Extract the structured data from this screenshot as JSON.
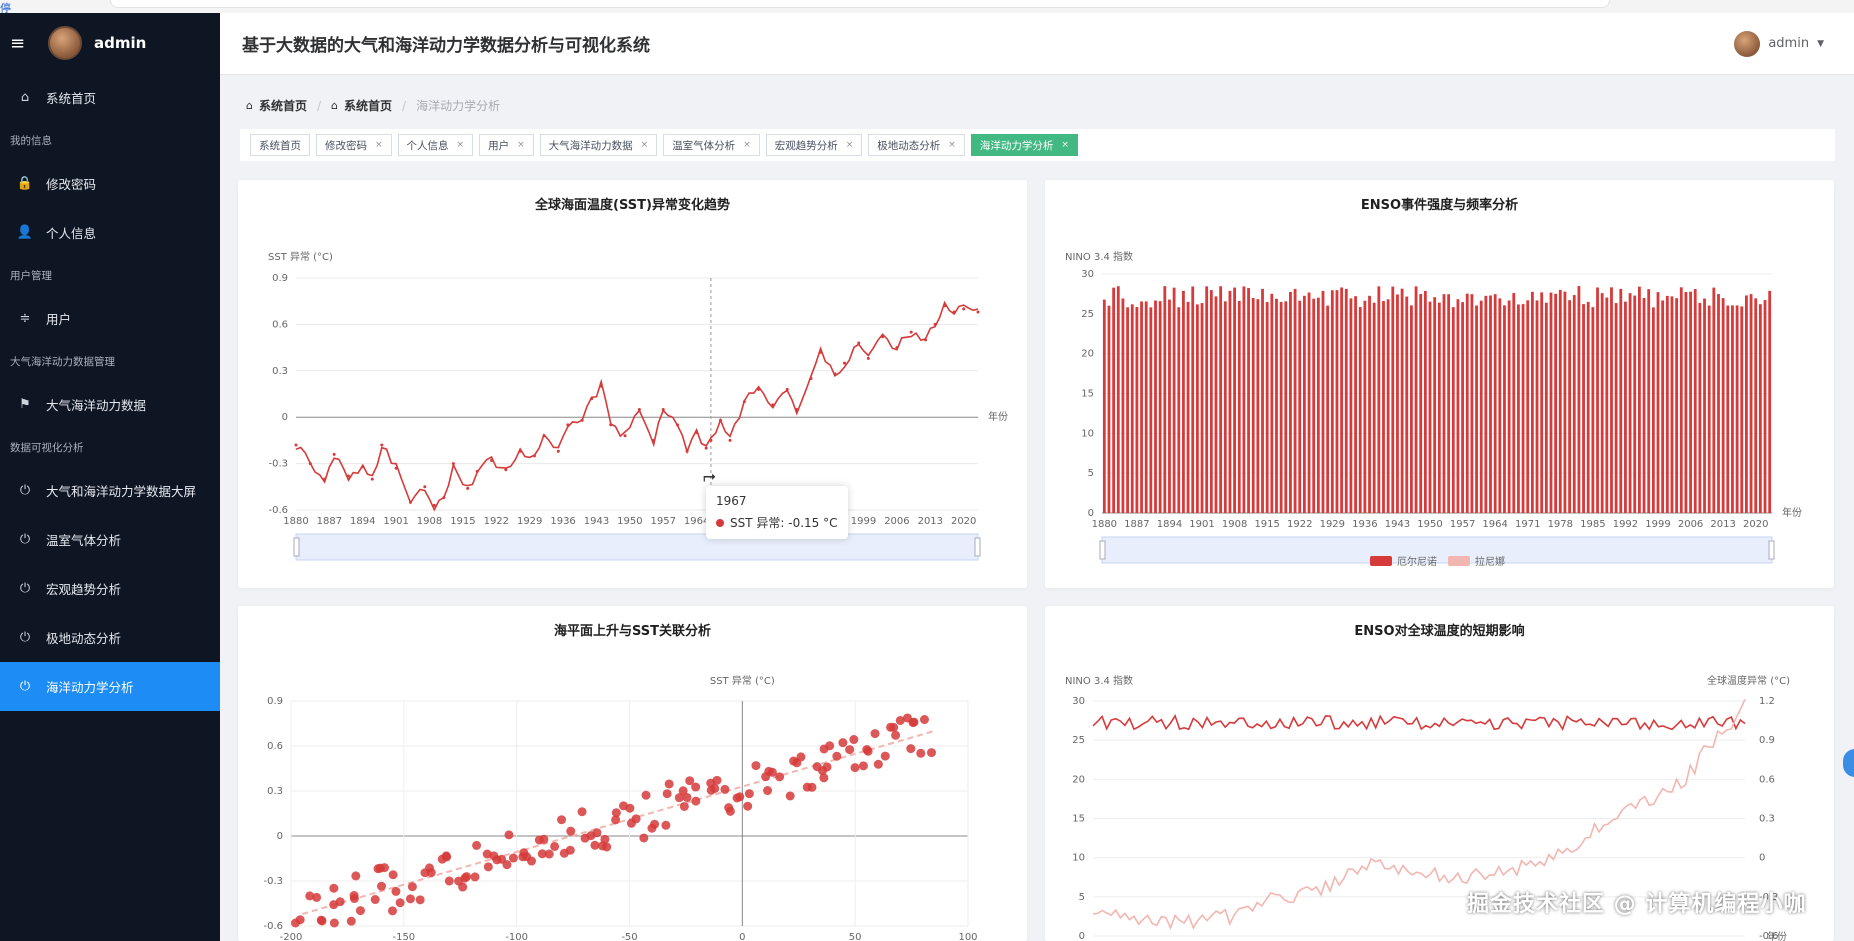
{
  "corner_glyph": "停",
  "sidebar": {
    "username": "admin",
    "items": [
      {
        "type": "item",
        "icon": "home-icon",
        "glyph": "⌂",
        "label": "系统首页"
      },
      {
        "type": "group",
        "label": "我的信息"
      },
      {
        "type": "item",
        "icon": "lock-icon",
        "glyph": "🔒",
        "label": "修改密码"
      },
      {
        "type": "item",
        "icon": "user-icon",
        "glyph": "👤",
        "label": "个人信息"
      },
      {
        "type": "group",
        "label": "用户管理"
      },
      {
        "type": "item",
        "icon": "sliders-icon",
        "glyph": "≑",
        "label": "用户"
      },
      {
        "type": "group",
        "label": "大气海洋动力数据管理"
      },
      {
        "type": "item",
        "icon": "flag-icon",
        "glyph": "⚑",
        "label": "大气海洋动力数据"
      },
      {
        "type": "group",
        "label": "数据可视化分析"
      },
      {
        "type": "item",
        "icon": "power-icon",
        "glyph": "⏻",
        "label": "大气和海洋动力学数据大屏"
      },
      {
        "type": "item",
        "icon": "power-icon",
        "glyph": "⏻",
        "label": "温室气体分析"
      },
      {
        "type": "item",
        "icon": "power-icon",
        "glyph": "⏻",
        "label": "宏观趋势分析"
      },
      {
        "type": "item",
        "icon": "power-icon",
        "glyph": "⏻",
        "label": "极地动态分析"
      },
      {
        "type": "item",
        "icon": "power-icon",
        "glyph": "⏻",
        "label": "海洋动力学分析",
        "active": true
      }
    ]
  },
  "header": {
    "title": "基于大数据的大气和海洋动力学数据分析与可视化系统",
    "username": "admin"
  },
  "breadcrumb": [
    "系统首页",
    "系统首页",
    "海洋动力学分析"
  ],
  "tags": [
    {
      "label": "系统首页",
      "closable": false
    },
    {
      "label": "修改密码",
      "closable": true
    },
    {
      "label": "个人信息",
      "closable": true
    },
    {
      "label": "用户",
      "closable": true
    },
    {
      "label": "大气海洋动力数据",
      "closable": true
    },
    {
      "label": "温室气体分析",
      "closable": true
    },
    {
      "label": "宏观趋势分析",
      "closable": true
    },
    {
      "label": "极地动态分析",
      "closable": true
    },
    {
      "label": "海洋动力学分析",
      "closable": true,
      "active": true
    }
  ],
  "colors": {
    "accent": "#1e8cf5",
    "tag_active": "#42b983",
    "series_red": "#d63a3a",
    "series_pink": "#f2b6b0"
  },
  "tooltip": {
    "title": "1967",
    "series": "SST 异常",
    "value": "-0.15 °C"
  },
  "watermark": "掘金技术社区 @ 计算机编程小咖",
  "chart_data": [
    {
      "type": "line",
      "title": "全球海面温度(SST)异常变化趋势",
      "ylabel": "SST 异常 (°C)",
      "xlabel": "年份",
      "ylim": [
        -0.6,
        0.9
      ],
      "yticks": [
        -0.6,
        -0.3,
        0,
        0.3,
        0.6,
        0.9
      ],
      "xticks": [
        1880,
        1887,
        1894,
        1901,
        1908,
        1915,
        1922,
        1929,
        1936,
        1943,
        1950,
        1957,
        1964,
        1971,
        1978,
        1985,
        1992,
        1999,
        2006,
        2013,
        2020
      ],
      "anchors": [
        [
          1880,
          -0.18
        ],
        [
          1883,
          -0.3
        ],
        [
          1886,
          -0.4
        ],
        [
          1888,
          -0.24
        ],
        [
          1891,
          -0.38
        ],
        [
          1894,
          -0.32
        ],
        [
          1896,
          -0.4
        ],
        [
          1898,
          -0.18
        ],
        [
          1901,
          -0.33
        ],
        [
          1904,
          -0.55
        ],
        [
          1907,
          -0.45
        ],
        [
          1909,
          -0.57
        ],
        [
          1911,
          -0.52
        ],
        [
          1913,
          -0.3
        ],
        [
          1916,
          -0.46
        ],
        [
          1918,
          -0.35
        ],
        [
          1921,
          -0.28
        ],
        [
          1924,
          -0.34
        ],
        [
          1927,
          -0.22
        ],
        [
          1930,
          -0.25
        ],
        [
          1932,
          -0.12
        ],
        [
          1935,
          -0.22
        ],
        [
          1937,
          -0.05
        ],
        [
          1940,
          -0.02
        ],
        [
          1942,
          0.12
        ],
        [
          1944,
          0.2
        ],
        [
          1946,
          -0.05
        ],
        [
          1949,
          -0.12
        ],
        [
          1952,
          0.05
        ],
        [
          1955,
          -0.15
        ],
        [
          1957,
          0.05
        ],
        [
          1960,
          -0.05
        ],
        [
          1962,
          -0.22
        ],
        [
          1964,
          -0.1
        ],
        [
          1966,
          -0.2
        ],
        [
          1967,
          -0.15
        ],
        [
          1969,
          -0.02
        ],
        [
          1971,
          -0.15
        ],
        [
          1974,
          0.1
        ],
        [
          1977,
          0.18
        ],
        [
          1980,
          0.08
        ],
        [
          1983,
          0.18
        ],
        [
          1985,
          0.05
        ],
        [
          1988,
          0.25
        ],
        [
          1990,
          0.42
        ],
        [
          1993,
          0.28
        ],
        [
          1995,
          0.35
        ],
        [
          1998,
          0.48
        ],
        [
          2000,
          0.38
        ],
        [
          2003,
          0.52
        ],
        [
          2006,
          0.45
        ],
        [
          2009,
          0.55
        ],
        [
          2012,
          0.5
        ],
        [
          2014,
          0.6
        ],
        [
          2016,
          0.72
        ],
        [
          2018,
          0.68
        ],
        [
          2020,
          0.7
        ],
        [
          2023,
          0.68
        ]
      ],
      "tooltip_year": 1967
    },
    {
      "type": "bar",
      "title": "ENSO事件强度与频率分析",
      "ylabel": "NINO 3.4 指数",
      "xlabel": "年份",
      "ylim": [
        0,
        30
      ],
      "yticks": [
        0,
        5,
        10,
        15,
        20,
        25,
        30
      ],
      "xticks": [
        1880,
        1887,
        1894,
        1901,
        1908,
        1915,
        1922,
        1929,
        1936,
        1943,
        1950,
        1957,
        1964,
        1971,
        1978,
        1985,
        1992,
        1999,
        2006,
        2013,
        2020
      ],
      "x_start": 1880,
      "x_end": 2023,
      "value_min": 25.8,
      "value_max": 28.5,
      "legend": [
        "厄尔尼诺",
        "拉尼娜"
      ]
    },
    {
      "type": "scatter",
      "title": "海平面上升与SST关联分析",
      "ylabel": "SST 异常 (°C)",
      "xlim": [
        -200,
        100
      ],
      "ylim": [
        -0.6,
        0.9
      ],
      "xticks": [
        -200,
        -150,
        -100,
        -50,
        0,
        50,
        100
      ],
      "yticks": [
        -0.6,
        -0.3,
        0,
        0.3,
        0.6,
        0.9
      ],
      "x_range": [
        -195,
        85
      ],
      "trend": {
        "from": [
          -195,
          -0.52
        ],
        "to": [
          85,
          0.7
        ]
      }
    },
    {
      "type": "line",
      "title": "ENSO对全球温度的短期影响",
      "ylabel_left": "NINO 3.4 指数",
      "ylabel_right": "全球温度异常 (°C)",
      "xlabel": "年份",
      "ylim_left": [
        0,
        30
      ],
      "ylim_right": [
        -0.6,
        1.2
      ],
      "yticks_left": [
        0,
        5,
        10,
        15,
        20,
        25,
        30
      ],
      "yticks_right": [
        -0.6,
        -0.3,
        0,
        0.3,
        0.6,
        0.9,
        1.2
      ],
      "series": [
        {
          "name": "NINO 3.4 指数",
          "axis": "left",
          "range": [
            26,
            28.5
          ]
        },
        {
          "name": "全球温度异常",
          "axis": "right",
          "anchors": [
            [
              1880,
              -0.42
            ],
            [
              1900,
              -0.5
            ],
            [
              1910,
              -0.45
            ],
            [
              1920,
              -0.3
            ],
            [
              1930,
              -0.25
            ],
            [
              1940,
              -0.05
            ],
            [
              1950,
              -0.1
            ],
            [
              1960,
              -0.15
            ],
            [
              1970,
              -0.12
            ],
            [
              1980,
              0.0
            ],
            [
              1990,
              0.2
            ],
            [
              2000,
              0.4
            ],
            [
              2010,
              0.6
            ],
            [
              2015,
              0.85
            ],
            [
              2020,
              1.0
            ],
            [
              2023,
              1.18
            ]
          ]
        }
      ]
    }
  ]
}
